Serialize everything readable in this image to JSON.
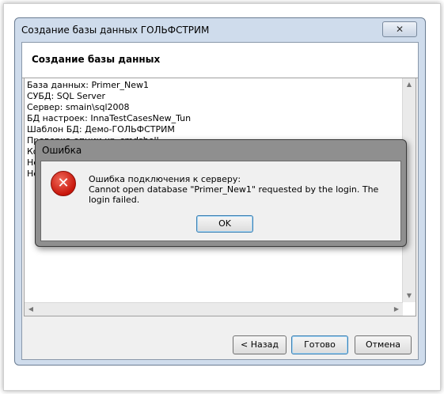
{
  "main_window": {
    "title": "Создание базы данных ГОЛЬФСТРИМ",
    "close_glyph": "✕",
    "header_title": "Создание базы данных",
    "log_lines": [
      "База данных: Primer_New1",
      "СУБД: SQL Server",
      "Сервер: smain\\sql2008",
      "БД настроек: InnaTestCasesNew_Tun",
      "Шаблон БД: Демо-ГОЛЬФСТРИМ",
      "Проверка опции xp_cmdshell",
      "Ко",
      "Не",
      "Не"
    ],
    "buttons": {
      "back": "< Назад",
      "done": "Готово",
      "cancel": "Отмена"
    }
  },
  "error_dialog": {
    "title": "Ошибка",
    "icon": "error-icon",
    "message_line1": "Ошибка подключения к серверу:",
    "message_line2": "Cannot open database \"Primer_New1\" requested by the login. The login failed.",
    "ok_label": "OK"
  },
  "colors": {
    "window_frame": "#cfdcec",
    "error_red": "#c8160b",
    "dialog_frame": "#8f8f8f"
  }
}
